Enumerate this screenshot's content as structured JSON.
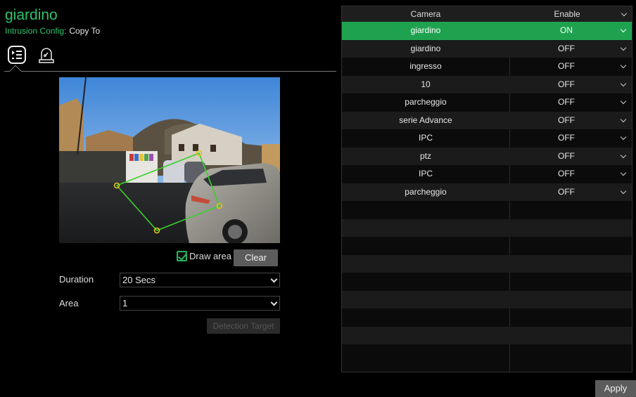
{
  "camera_name": "giardino",
  "subtitle": {
    "label": "Intrusion Config:",
    "copy_to": "Copy To"
  },
  "tabs": [
    {
      "icon": "list-settings-icon"
    },
    {
      "icon": "alarm-light-icon"
    }
  ],
  "controls": {
    "draw_area_label": "Draw area",
    "draw_area_checked": true,
    "clear_label": "Clear",
    "duration_label": "Duration",
    "duration_value": "20 Secs",
    "area_label": "Area",
    "area_value": "1",
    "detection_target_label": "Detection Target"
  },
  "table": {
    "headers": {
      "camera": "Camera",
      "enable": "Enable"
    },
    "rows": [
      {
        "camera": "giardino",
        "enable": "ON",
        "selected": true
      },
      {
        "camera": "giardino",
        "enable": "OFF"
      },
      {
        "camera": "ingresso",
        "enable": "OFF"
      },
      {
        "camera": "10",
        "enable": "OFF"
      },
      {
        "camera": "parcheggio",
        "enable": "OFF"
      },
      {
        "camera": "serie Advance",
        "enable": "OFF"
      },
      {
        "camera": "IPC",
        "enable": "OFF"
      },
      {
        "camera": "ptz",
        "enable": "OFF"
      },
      {
        "camera": "IPC",
        "enable": "OFF"
      },
      {
        "camera": "parcheggio",
        "enable": "OFF"
      }
    ]
  },
  "apply_label": "Apply",
  "colors": {
    "accent": "#2ec36b",
    "selected_row": "#1fa24f",
    "zone_line": "#39d12b"
  }
}
